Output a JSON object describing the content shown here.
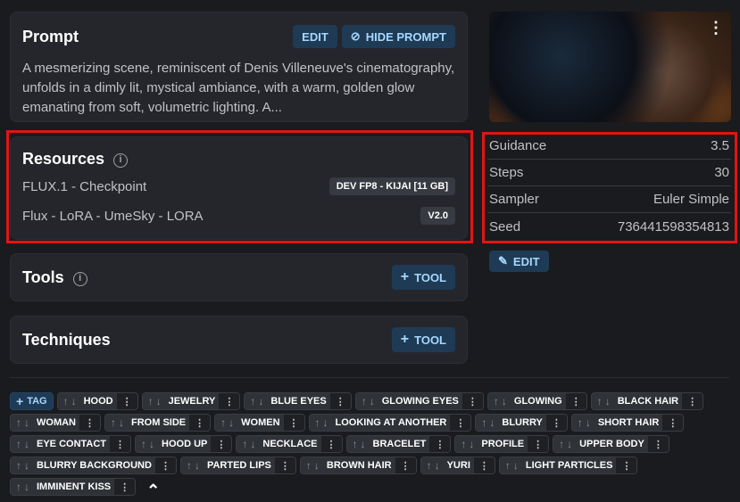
{
  "prompt": {
    "title": "Prompt",
    "edit": "EDIT",
    "hide": "HIDE PROMPT",
    "text": "A mesmerizing scene, reminiscent of Denis Villeneuve's cinematography, unfolds in a dimly lit, mystical ambiance, with a warm, golden glow emanating from soft, volumetric lighting. A..."
  },
  "resources": {
    "title": "Resources",
    "items": [
      {
        "name": "FLUX.1 - Checkpoint",
        "badge": "DEV FP8 - KIJAI [11 GB]"
      },
      {
        "name": "Flux - LoRA - UmeSky - LORA",
        "badge": "V2.0"
      }
    ]
  },
  "tools": {
    "title": "Tools",
    "button": "TOOL"
  },
  "techniques": {
    "title": "Techniques",
    "button": "TOOL"
  },
  "params": [
    {
      "label": "Guidance",
      "value": "3.5"
    },
    {
      "label": "Steps",
      "value": "30"
    },
    {
      "label": "Sampler",
      "value": "Euler Simple"
    },
    {
      "label": "Seed",
      "value": "736441598354813"
    }
  ],
  "params_edit": "EDIT",
  "add_tag": "TAG",
  "tags": [
    "HOOD",
    "JEWELRY",
    "BLUE EYES",
    "GLOWING EYES",
    "GLOWING",
    "BLACK HAIR",
    "WOMAN",
    "FROM SIDE",
    "WOMEN",
    "LOOKING AT ANOTHER",
    "BLURRY",
    "SHORT HAIR",
    "EYE CONTACT",
    "HOOD UP",
    "NECKLACE",
    "BRACELET",
    "PROFILE",
    "UPPER BODY",
    "BLURRY BACKGROUND",
    "PARTED LIPS",
    "BROWN HAIR",
    "YURI",
    "LIGHT PARTICLES",
    "IMMINENT KISS"
  ]
}
